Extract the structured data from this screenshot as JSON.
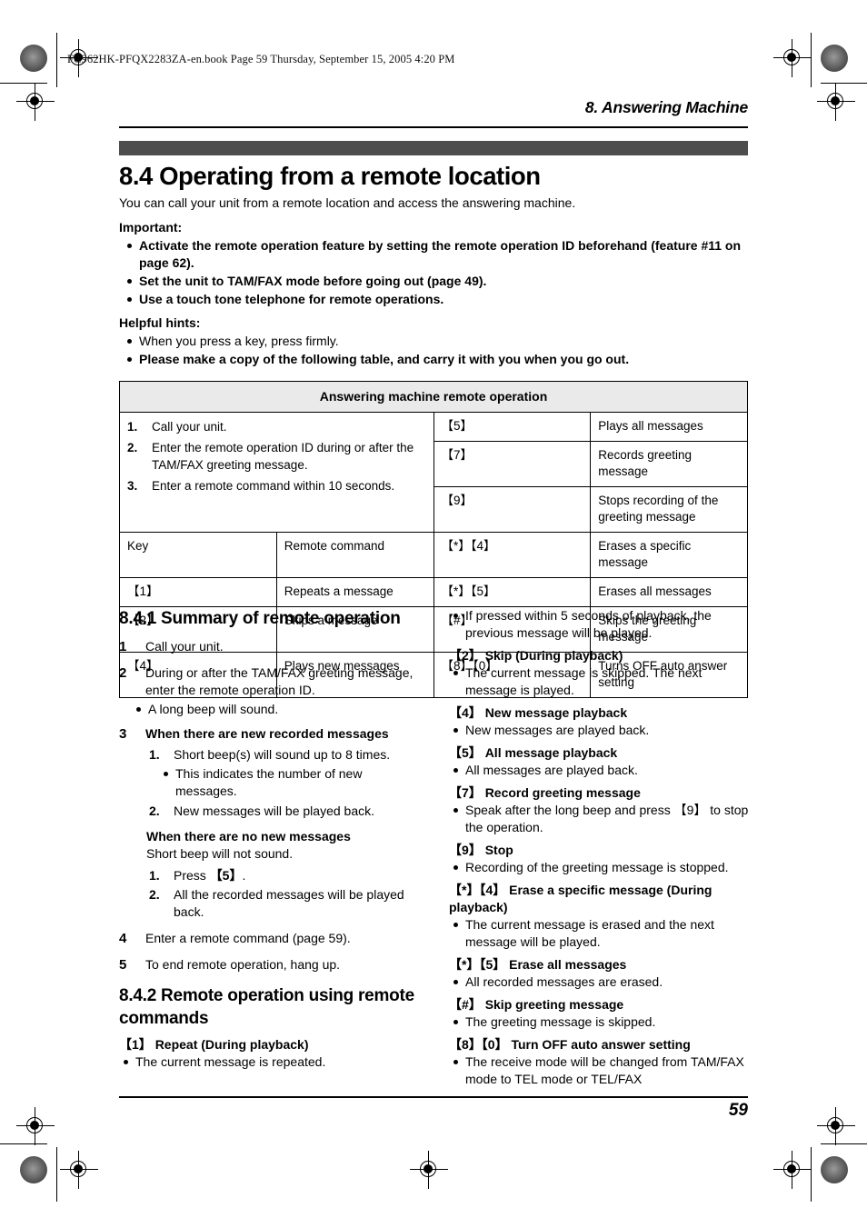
{
  "file_header": "FC962HK-PFQX2283ZA-en.book  Page 59  Thursday, September 15, 2005  4:20 PM",
  "running_head": "8. Answering Machine",
  "page_number": "59",
  "colors": {
    "gray_bar": "#4d4d4d",
    "table_caption_bg": "#eaeaea",
    "text": "#000000"
  },
  "section": {
    "title": "8.4 Operating from a remote location",
    "lead": "You can call your unit from a remote location and access the answering machine.",
    "important_label": "Important:",
    "important_items": [
      "Activate the remote operation feature by setting the remote operation ID beforehand (feature #11 on page 62).",
      "Set the unit to TAM/FAX mode before going out (page 49).",
      "Use a touch tone telephone for remote operations."
    ],
    "hints_label": "Helpful hints:",
    "hints_items": [
      {
        "text": "When you press a key, press firmly.",
        "bold": false
      },
      {
        "text": "Please make a copy of the following table, and carry it with you when you go out.",
        "bold": true
      }
    ]
  },
  "table": {
    "caption": "Answering machine remote operation",
    "steps": [
      {
        "n": "1.",
        "text": "Call your unit."
      },
      {
        "n": "2.",
        "text": "Enter the remote operation ID during or after the TAM/FAX greeting message."
      },
      {
        "n": "3.",
        "text": "Enter a remote command within 10 seconds."
      }
    ],
    "left_headers": {
      "key": "Key",
      "command": "Remote command"
    },
    "left_rows": [
      {
        "key": "【1】",
        "command": "Repeats a message"
      },
      {
        "key": "【2】",
        "command": "Skips a message"
      },
      {
        "key": "【4】",
        "command": "Plays new messages"
      }
    ],
    "right_rows": [
      {
        "key": "【5】",
        "command": "Plays all messages"
      },
      {
        "key": "【7】",
        "command": "Records greeting message"
      },
      {
        "key": "【9】",
        "command": "Stops recording of the greeting message"
      },
      {
        "key": "【*】【4】",
        "command": "Erases a specific message"
      },
      {
        "key": "【*】【5】",
        "command": "Erases all messages"
      },
      {
        "key": "【#】",
        "command": "Skips the greeting message"
      },
      {
        "key": "【8】【0】",
        "command": "Turns OFF auto answer setting"
      }
    ]
  },
  "summary": {
    "heading": "8.4.1 Summary of remote operation",
    "step1": {
      "n": "1",
      "text": "Call your unit."
    },
    "step2": {
      "n": "2",
      "text": "During or after the TAM/FAX greeting message, enter the remote operation ID.",
      "bullet": "A long beep will sound."
    },
    "step3": {
      "n": "3",
      "title": "When there are new recorded messages",
      "sub1": {
        "n": "1.",
        "text": "Short beep(s) will sound up to 8 times.",
        "bullet": "This indicates the number of new messages."
      },
      "sub2": {
        "n": "2.",
        "text": "New messages will be played back."
      },
      "no_new_title": "When there are no new messages",
      "no_new_text": "Short beep will not sound.",
      "no_new_1_n": "1.",
      "no_new_1_a": "Press ",
      "no_new_1_key": "【5】",
      "no_new_1_b": ".",
      "no_new_2": {
        "n": "2.",
        "text": "All the recorded messages will be played back."
      }
    },
    "step4": {
      "n": "4",
      "text": "Enter a remote command (page 59)."
    },
    "step5": {
      "n": "5",
      "text": "To end remote operation, hang up."
    }
  },
  "commands": {
    "heading": "8.4.2 Remote operation using remote commands",
    "items": [
      {
        "key": "【1】",
        "title": "Repeat (During playback)",
        "bullets": [
          "The current message is repeated.",
          "If pressed within 5 seconds of playback, the previous message will be played."
        ]
      },
      {
        "key": "【2】",
        "title": "Skip (During playback)",
        "bullets": [
          "The current message is skipped. The next message is played."
        ]
      },
      {
        "key": "【4】",
        "title": "New message playback",
        "bullets": [
          "New messages are played back."
        ]
      },
      {
        "key": "【5】",
        "title": "All message playback",
        "bullets": [
          "All messages are played back."
        ]
      },
      {
        "key": "【7】",
        "title": "Record greeting message",
        "bullets": [
          "Speak after the long beep and press 【9】 to stop the operation."
        ]
      },
      {
        "key": "【9】",
        "title": "Stop",
        "bullets": [
          "Recording of the greeting message is stopped."
        ]
      },
      {
        "key": "【*】【4】",
        "title": "Erase a specific message (During playback)",
        "bullets": [
          "The current message is erased and the next message will be played."
        ]
      },
      {
        "key": "【*】【5】",
        "title": "Erase all messages",
        "bullets": [
          "All recorded messages are erased."
        ]
      },
      {
        "key": "【#】",
        "title": "Skip greeting message",
        "bullets": [
          "The greeting message is skipped."
        ]
      },
      {
        "key": "【8】【0】",
        "title": "Turn OFF auto answer setting",
        "bullets": [
          "The receive mode will be changed from TAM/FAX mode to TEL mode or TEL/FAX"
        ]
      }
    ]
  }
}
